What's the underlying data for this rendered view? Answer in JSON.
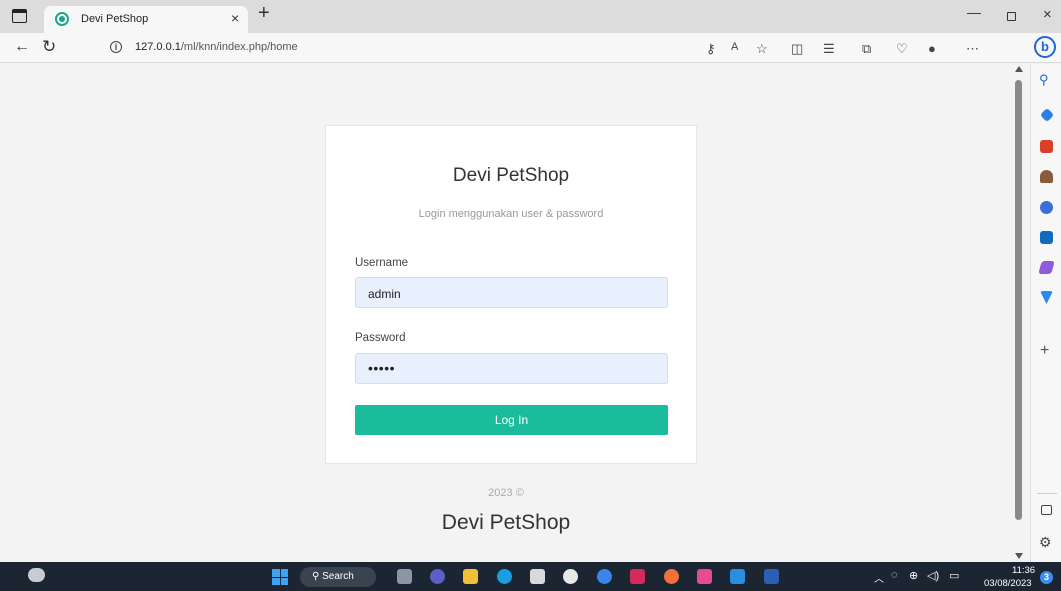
{
  "browser": {
    "tab_title": "Devi PetShop",
    "tab_close": "×",
    "new_tab": "+",
    "url_host": "127.0.0.1",
    "url_path": "/ml/knn/index.php/home",
    "window_min": "—",
    "window_close": "×",
    "back": "←",
    "reload": "↻"
  },
  "login": {
    "title": "Devi PetShop",
    "subtitle": "Login menggunakan user & password",
    "username_label": "Username",
    "username_value": "admin",
    "password_label": "Password",
    "password_value": "•••••",
    "button_label": "Log In"
  },
  "footer": {
    "year": "2023 ©",
    "brand": "Devi PetShop"
  },
  "taskbar": {
    "search_label": "Search",
    "time": "11:36",
    "date": "03/08/2023",
    "notification_count": "3"
  },
  "colors": {
    "accent": "#1abc9c",
    "taskbar": "#1c2633",
    "field_bg": "#e8f0fe"
  }
}
